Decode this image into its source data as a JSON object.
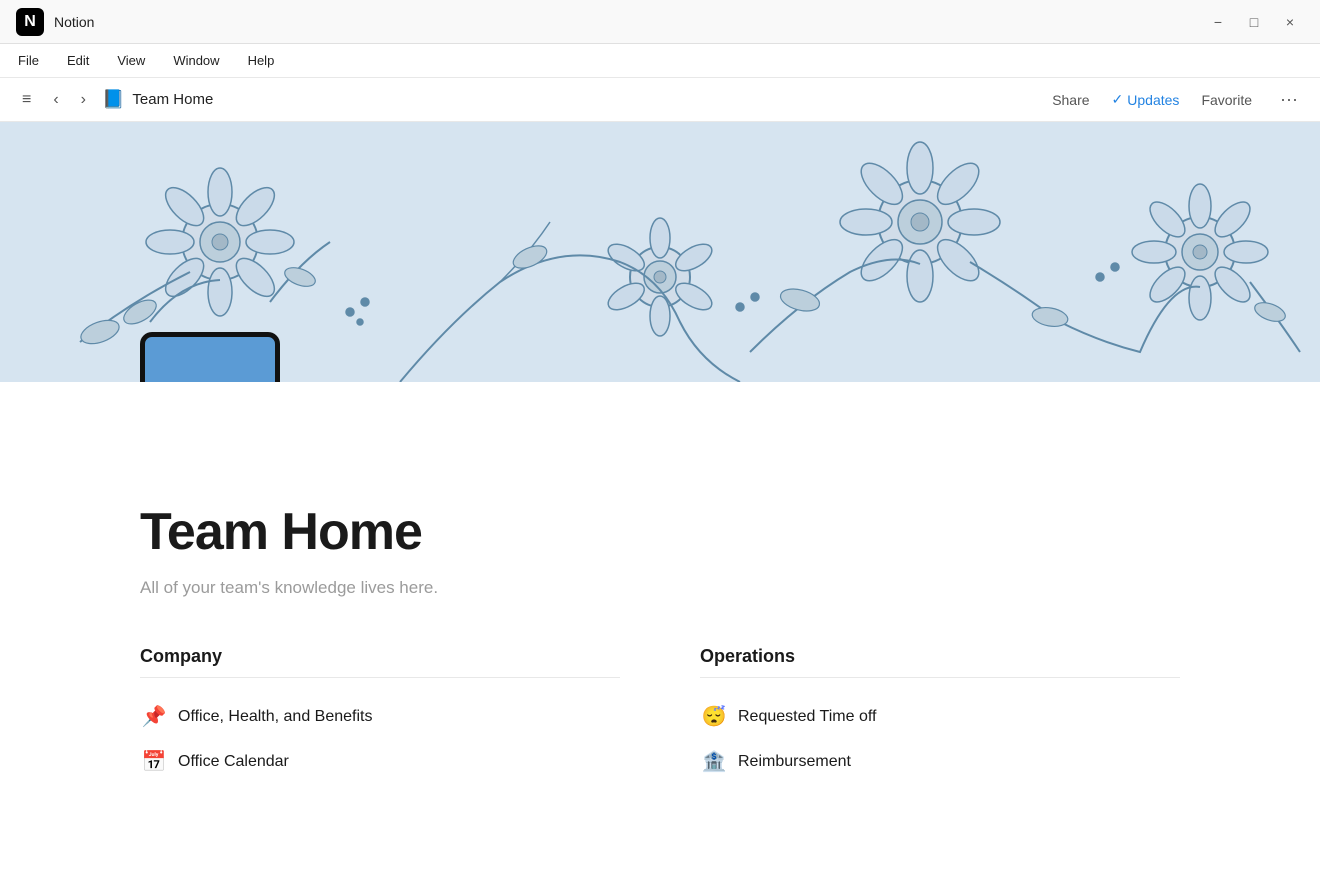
{
  "titlebar": {
    "app_icon": "N",
    "app_name": "Notion",
    "minimize_label": "−",
    "maximize_label": "□",
    "close_label": "×"
  },
  "menubar": {
    "items": [
      "File",
      "Edit",
      "View",
      "Window",
      "Help"
    ]
  },
  "toolbar": {
    "hamburger": "≡",
    "back": "‹",
    "forward": "›",
    "page_icon": "📘",
    "page_title": "Team Home",
    "share_label": "Share",
    "updates_check": "✓",
    "updates_label": "Updates",
    "favorite_label": "Favorite",
    "more_label": "···"
  },
  "cover": {
    "alt": "Blue floral botanical pattern cover image"
  },
  "page": {
    "title": "Team Home",
    "subtitle": "All of your team's knowledge lives here."
  },
  "sections": [
    {
      "id": "company",
      "header": "Company",
      "items": [
        {
          "emoji": "📌",
          "label": "Office, Health, and Benefits"
        },
        {
          "emoji": "📅",
          "label": "Office Calendar"
        }
      ]
    },
    {
      "id": "operations",
      "header": "Operations",
      "items": [
        {
          "emoji": "😴",
          "label": "Requested Time off"
        },
        {
          "emoji": "🏦",
          "label": "Reimbursement"
        }
      ]
    }
  ]
}
